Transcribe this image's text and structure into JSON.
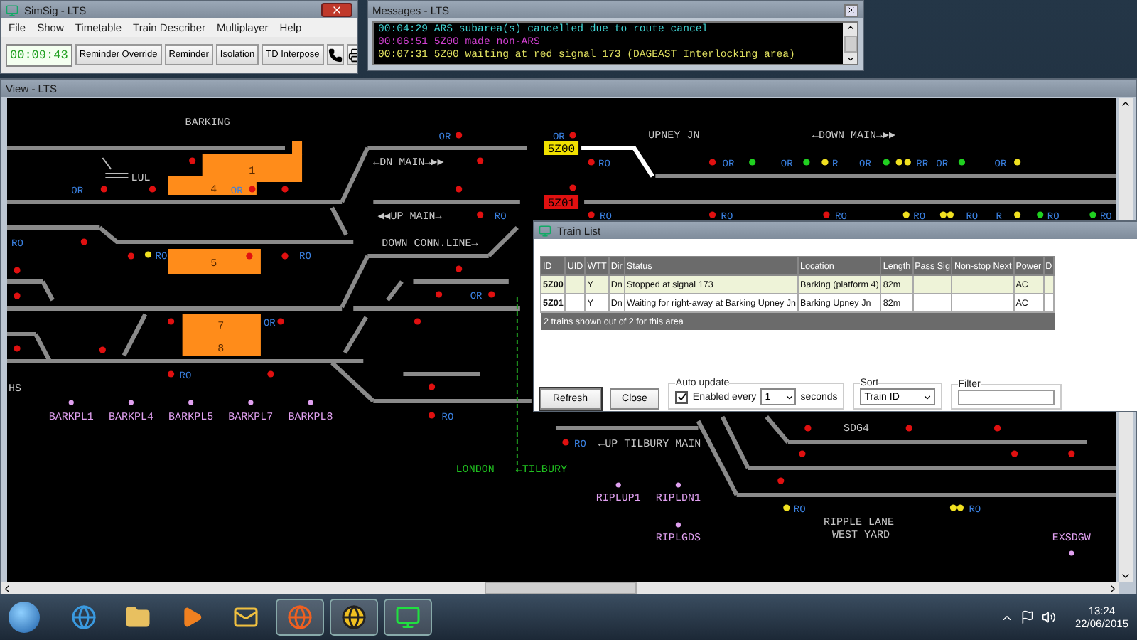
{
  "main_window": {
    "title": "SimSig - LTS",
    "menu": [
      "File",
      "Show",
      "Timetable",
      "Train Describer",
      "Multiplayer",
      "Help"
    ],
    "clock": "00:09:43",
    "buttons": [
      "Reminder Override",
      "Reminder",
      "Isolation",
      "TD Interpose"
    ]
  },
  "messages_window": {
    "title": "Messages - LTS",
    "messages": [
      {
        "text": "00:04:29 ARS subarea(s) cancelled due to route cancel",
        "color": "#40d0d0"
      },
      {
        "text": "00:06:51 5Z00 made non-ARS",
        "color": "#d040d0"
      },
      {
        "text": "00:07:31 5Z00 waiting at red signal 173 (DAGEAST Interlocking area)",
        "color": "#e0e060"
      }
    ]
  },
  "view_window": {
    "title": "View - LTS",
    "area_labels": [
      {
        "text": "BARKING",
        "color": "#c8c8c8"
      },
      {
        "text": "LUL",
        "color": "#c8c8c8"
      },
      {
        "text": "←DN MAIN→▶▶",
        "color": "#c8c8c8"
      },
      {
        "text": "◀◀UP MAIN→",
        "color": "#c8c8c8"
      },
      {
        "text": "DOWN CONN.LINE→",
        "color": "#c8c8c8"
      },
      {
        "text": "UPNEY JN",
        "color": "#c8c8c8"
      },
      {
        "text": "←DOWN MAIN→▶▶",
        "color": "#c8c8c8"
      },
      {
        "text": "←UP TILBURY MAIN",
        "color": "#c8c8c8"
      },
      {
        "text": "LONDON",
        "color": "#20c020"
      },
      {
        "text": "←TILBURY",
        "color": "#20c020"
      },
      {
        "text": "SDG4",
        "color": "#c8c8c8"
      },
      {
        "text": "RIPPLE LANE",
        "color": "#c8c8c8"
      },
      {
        "text": "WEST YARD",
        "color": "#c8c8c8"
      },
      {
        "text": "HS",
        "color": "#c8c8c8"
      }
    ],
    "platforms": [
      "1",
      "4",
      "5",
      "7",
      "8"
    ],
    "berths": [
      {
        "text": "5Z00",
        "color": "#f0e000"
      },
      {
        "text": "5Z01",
        "color": "#e01010"
      }
    ],
    "signal_labels": [
      "OR",
      "OR",
      "OR",
      "OR",
      "RO",
      "RO",
      "RO",
      "RO",
      "OR",
      "OR",
      "RO",
      "RO",
      "RO",
      "OR",
      "OR",
      "R",
      "OR",
      "RR",
      "OR",
      "OR",
      "RO",
      "RO",
      "RO",
      "RO",
      "RO",
      "R",
      "RO",
      "RO",
      "RO",
      "RO",
      "RO"
    ],
    "signals": [
      {
        "color": "#e01010"
      },
      {
        "color": "#e01010"
      },
      {
        "color": "#e01010"
      },
      {
        "color": "#e01010"
      },
      {
        "color": "#e01010"
      },
      {
        "color": "#e01010"
      },
      {
        "color": "#e01010"
      },
      {
        "color": "#e01010"
      },
      {
        "color": "#e01010"
      },
      {
        "color": "#e01010"
      },
      {
        "color": "#e01010"
      },
      {
        "color": "#e01010"
      },
      {
        "color": "#e01010"
      },
      {
        "color": "#e01010"
      },
      {
        "color": "#e01010"
      },
      {
        "color": "#e01010"
      },
      {
        "color": "#e01010"
      },
      {
        "color": "#e01010"
      },
      {
        "color": "#e01010"
      },
      {
        "color": "#e01010"
      },
      {
        "color": "#e01010"
      },
      {
        "color": "#e01010"
      },
      {
        "color": "#e01010"
      },
      {
        "color": "#e01010"
      },
      {
        "color": "#e01010"
      },
      {
        "color": "#e01010"
      },
      {
        "color": "#e01010"
      },
      {
        "color": "#f0e020"
      },
      {
        "color": "#e01010"
      },
      {
        "color": "#e01010"
      },
      {
        "color": "#e01010"
      },
      {
        "color": "#20d020"
      },
      {
        "color": "#20d020"
      },
      {
        "color": "#f0e020"
      },
      {
        "color": "#20d020"
      },
      {
        "color": "#f0e020"
      },
      {
        "color": "#f0e020"
      },
      {
        "color": "#20d020"
      },
      {
        "color": "#f0e020"
      },
      {
        "color": "#e01010"
      },
      {
        "color": "#e01010"
      },
      {
        "color": "#e01010"
      },
      {
        "color": "#e01010"
      },
      {
        "color": "#f0e020"
      },
      {
        "color": "#f0e020"
      },
      {
        "color": "#f0e020"
      },
      {
        "color": "#f0e020"
      },
      {
        "color": "#20d020"
      },
      {
        "color": "#20d020"
      },
      {
        "color": "#e01010"
      },
      {
        "color": "#e01010"
      },
      {
        "color": "#e01010"
      },
      {
        "color": "#e01010"
      },
      {
        "color": "#e01010"
      },
      {
        "color": "#e01010"
      },
      {
        "color": "#e01010"
      },
      {
        "color": "#e01010"
      },
      {
        "color": "#f0e020"
      },
      {
        "color": "#f0e020"
      },
      {
        "color": "#f0e020"
      }
    ],
    "location_labels": [
      "BARKPL1",
      "BARKPL4",
      "BARKPL5",
      "BARKPL7",
      "BARKPL8",
      "RIPLUP1",
      "RIPLDN1",
      "RIPLGDS",
      "EXSDGW"
    ]
  },
  "train_list": {
    "title": "Train List",
    "columns": [
      "ID",
      "UID",
      "WTT",
      "Dir",
      "Status",
      "Location",
      "Length",
      "Pass Sig",
      "Non-stop Next",
      "Power",
      "D"
    ],
    "rows": [
      {
        "selected": true,
        "id": "5Z00",
        "wtt": "Y",
        "dir": "Dn",
        "status": "Stopped at signal 173",
        "location": "Barking (platform 4)",
        "length": "82m",
        "power": "AC"
      },
      {
        "selected": false,
        "id": "5Z01",
        "wtt": "Y",
        "dir": "Dn",
        "status": "Waiting for right-away at Barking Upney Jn",
        "location": "Barking Upney Jn",
        "length": "82m",
        "power": "AC"
      }
    ],
    "summary": "2 trains shown out of 2 for this area",
    "buttons": [
      "Refresh",
      "Close"
    ],
    "auto_update": {
      "label": "Auto update",
      "checked": true,
      "checkbox_label": "Enabled every",
      "interval": "1",
      "unit": "seconds"
    },
    "sort": {
      "label": "Sort",
      "value": "Train ID"
    },
    "filter": {
      "label": "Filter"
    }
  },
  "taskbar": {
    "time": "13:24",
    "date": "22/06/2015"
  }
}
